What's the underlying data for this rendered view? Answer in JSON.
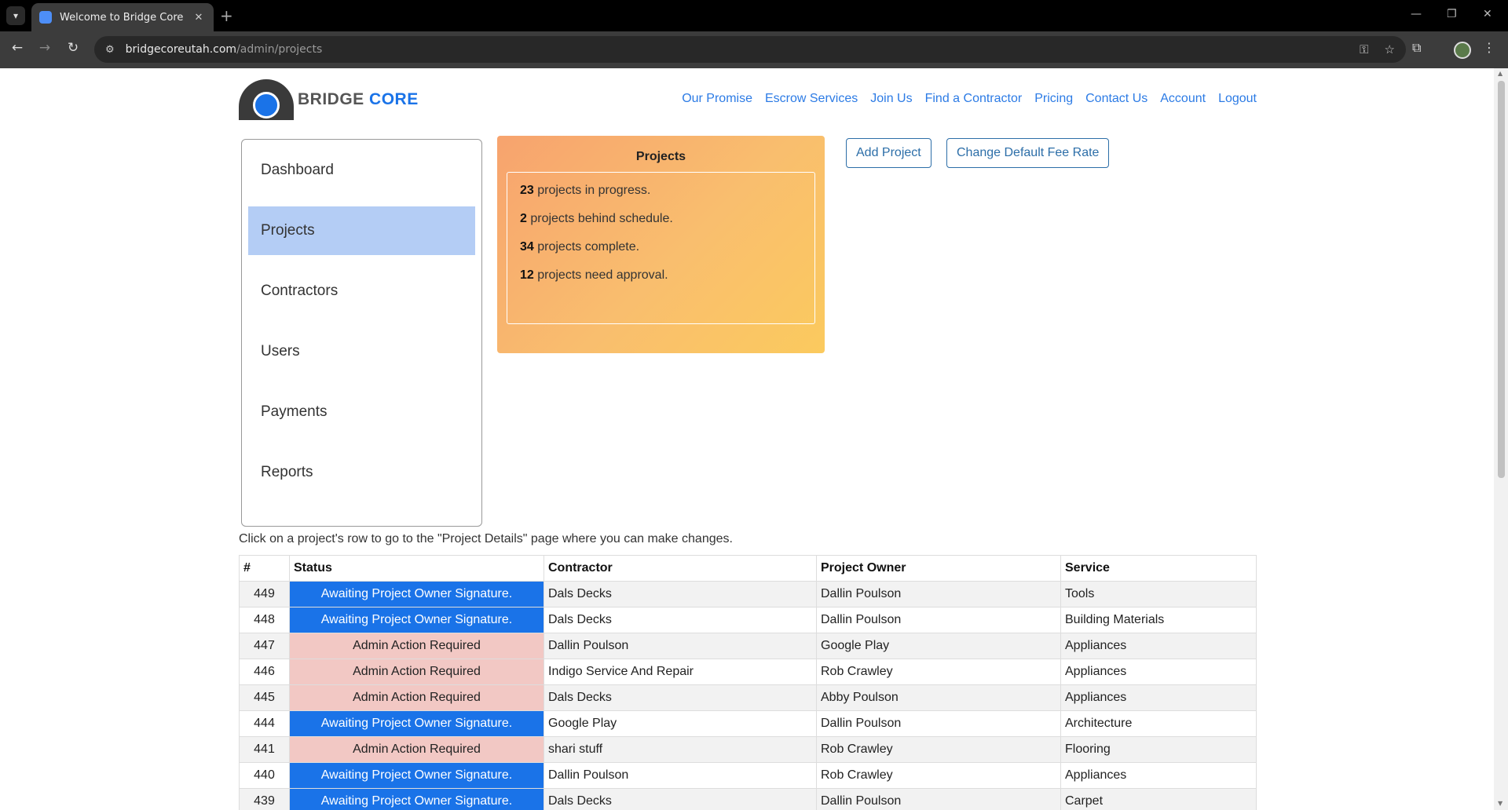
{
  "browser": {
    "tab_title": "Welcome to Bridge Core",
    "url_host": "bridgecoreutah.com",
    "url_path": "/admin/projects"
  },
  "site": {
    "logo_part1": "BRIDGE",
    "logo_part2": "CORE",
    "nav": [
      "Our Promise",
      "Escrow Services",
      "Join Us",
      "Find a Contractor",
      "Pricing",
      "Contact Us",
      "Account",
      "Logout"
    ]
  },
  "sidebar": {
    "items": [
      {
        "label": "Dashboard",
        "active": false
      },
      {
        "label": "Projects",
        "active": true
      },
      {
        "label": "Contractors",
        "active": false
      },
      {
        "label": "Users",
        "active": false
      },
      {
        "label": "Payments",
        "active": false
      },
      {
        "label": "Reports",
        "active": false
      }
    ]
  },
  "stats": {
    "title": "Projects",
    "rows": [
      {
        "count": "23",
        "text": " projects in progress."
      },
      {
        "count": "2",
        "text": " projects behind schedule."
      },
      {
        "count": "34",
        "text": " projects complete."
      },
      {
        "count": "12",
        "text": " projects need approval."
      }
    ]
  },
  "actions": {
    "add_project": "Add Project",
    "change_fee": "Change Default Fee Rate"
  },
  "hint": "Click on a project's row to go to the \"Project Details\" page where you can make changes.",
  "table": {
    "headers": [
      "#",
      "Status",
      "Contractor",
      "Project Owner",
      "Service"
    ],
    "rows": [
      {
        "id": "449",
        "status": "Awaiting Project Owner Signature.",
        "kind": "blue",
        "contractor": "Dals Decks",
        "owner": "Dallin Poulson",
        "service": "Tools"
      },
      {
        "id": "448",
        "status": "Awaiting Project Owner Signature.",
        "kind": "blue",
        "contractor": "Dals Decks",
        "owner": "Dallin Poulson",
        "service": "Building Materials"
      },
      {
        "id": "447",
        "status": "Admin Action Required",
        "kind": "pink",
        "contractor": "Dallin Poulson",
        "owner": "Google Play",
        "service": "Appliances"
      },
      {
        "id": "446",
        "status": "Admin Action Required",
        "kind": "pink",
        "contractor": "Indigo Service And Repair",
        "owner": "Rob Crawley",
        "service": "Appliances"
      },
      {
        "id": "445",
        "status": "Admin Action Required",
        "kind": "pink",
        "contractor": "Dals Decks",
        "owner": "Abby Poulson",
        "service": "Appliances"
      },
      {
        "id": "444",
        "status": "Awaiting Project Owner Signature.",
        "kind": "blue",
        "contractor": "Google Play",
        "owner": "Dallin Poulson",
        "service": "Architecture"
      },
      {
        "id": "441",
        "status": "Admin Action Required",
        "kind": "pink",
        "contractor": "shari stuff",
        "owner": "Rob Crawley",
        "service": "Flooring"
      },
      {
        "id": "440",
        "status": "Awaiting Project Owner Signature.",
        "kind": "blue",
        "contractor": "Dallin Poulson",
        "owner": "Rob Crawley",
        "service": "Appliances"
      },
      {
        "id": "439",
        "status": "Awaiting Project Owner Signature.",
        "kind": "blue",
        "contractor": "Dals Decks",
        "owner": "Dallin Poulson",
        "service": "Carpet"
      }
    ]
  },
  "colors": {
    "accent": "#1a73e8",
    "active_sidebar": "#b4cdf5",
    "status_blue": "#1a73e8",
    "status_pink": "#f2c8c4"
  }
}
